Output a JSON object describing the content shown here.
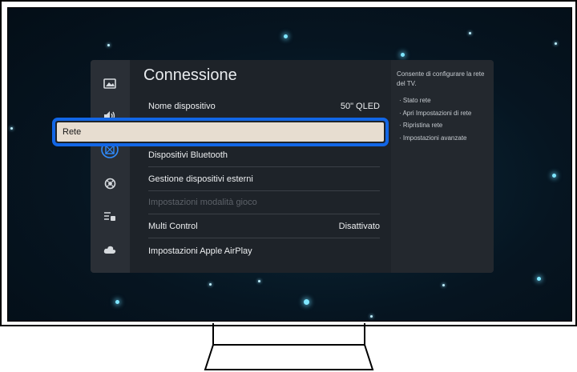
{
  "panel": {
    "title": "Connessione",
    "items": [
      {
        "label": "Nome dispositivo",
        "value": "50\" QLED"
      },
      {
        "label": "Rete",
        "value": ""
      },
      {
        "label": "Dispositivi Bluetooth",
        "value": ""
      },
      {
        "label": "Gestione dispositivi esterni",
        "value": ""
      },
      {
        "label": "Impostazioni modalità gioco",
        "value": ""
      },
      {
        "label": "Multi Control",
        "value": "Disattivato"
      },
      {
        "label": "Impostazioni Apple AirPlay",
        "value": ""
      }
    ]
  },
  "sidebar": {
    "icons": [
      "picture-icon",
      "sound-icon",
      "connection-icon",
      "support-icon",
      "general-icon",
      "cloud-icon"
    ]
  },
  "info": {
    "description": "Consente di configurare la rete del TV.",
    "options": [
      "Stato rete",
      "Apri Impostazioni di rete",
      "Ripristina rete",
      "Impostazioni avanzate"
    ]
  },
  "colors": {
    "focus": "#1266e6",
    "selected_bg": "#e7ddd0",
    "panel_bg": "#1e2329"
  }
}
